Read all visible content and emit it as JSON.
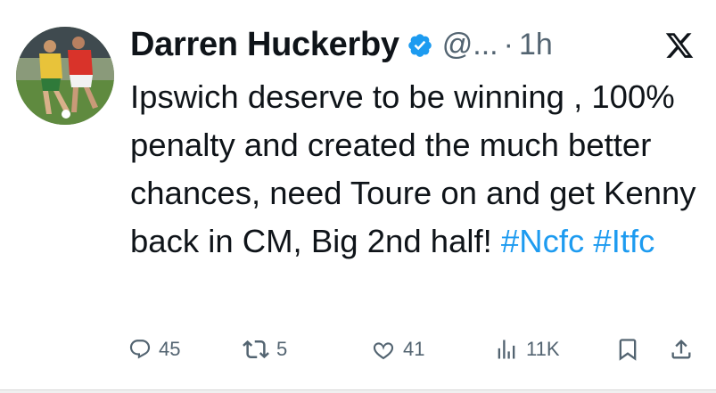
{
  "tweet": {
    "author_name": "Darren Huckerby",
    "handle": "@...",
    "separator": "·",
    "time": "1h",
    "text_main": "Ipswich deserve to be winning , 100% penalty and created the much better chances, need Toure on and get Kenny back in CM, Big 2nd half!",
    "hashtags": [
      "#Ncfc",
      "#Itfc"
    ]
  },
  "actions": {
    "replies": "45",
    "reposts": "5",
    "likes": "41",
    "views": "11K"
  },
  "icons": {
    "verified": "verified-badge-icon",
    "platform": "x-logo-icon",
    "reply": "reply-icon",
    "repost": "repost-icon",
    "like": "like-icon",
    "views": "views-icon",
    "bookmark": "bookmark-icon",
    "share": "share-icon"
  },
  "colors": {
    "text": "#0f1419",
    "muted": "#536471",
    "accent": "#1d9bf0"
  }
}
